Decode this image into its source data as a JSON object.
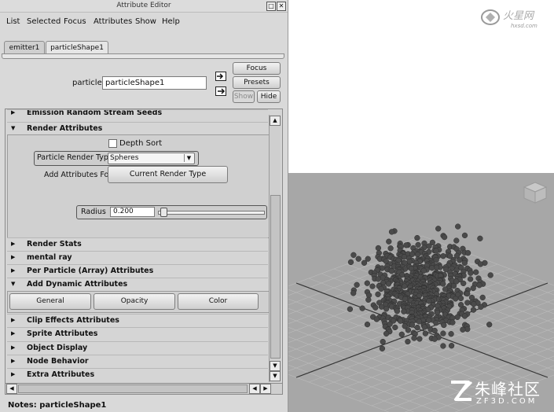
{
  "window": {
    "title": "Attribute Editor"
  },
  "menu": [
    "List",
    "Selected",
    "Focus",
    "Attributes",
    "Show",
    "Help"
  ],
  "tabs": [
    {
      "label": "emitter1"
    },
    {
      "label": "particleShape1"
    }
  ],
  "header": {
    "particle_label": "particle:",
    "particle_value": "particleShape1",
    "focus": "Focus",
    "presets": "Presets",
    "show": "Show",
    "hide": "Hide"
  },
  "sections": {
    "emission": "Emission Random Stream Seeds",
    "render": "Render Attributes",
    "render_stats": "Render Stats",
    "mental_ray": "mental ray",
    "per_particle": "Per Particle (Array) Attributes",
    "add_dynamic": "Add Dynamic Attributes",
    "clip_effects": "Clip Effects Attributes",
    "sprite": "Sprite Attributes",
    "object_display": "Object Display",
    "node_behavior": "Node Behavior",
    "extra": "Extra Attributes"
  },
  "render_attrs": {
    "depth_sort": "Depth Sort",
    "depth_sort_checked": false,
    "render_type_label": "Particle Render Type",
    "render_type_value": "Spheres",
    "add_attrs_label": "Add Attributes For",
    "current_render_type": "Current Render Type",
    "radius_label": "Radius",
    "radius_value": "0.200",
    "radius_fraction": 0.02
  },
  "dynamic_buttons": {
    "general": "General",
    "opacity": "Opacity",
    "color": "Color"
  },
  "notes": "Notes:  particleShape1",
  "watermark": {
    "top": "火星网 hxsd.com",
    "bottom": "朱峰社区",
    "bottom_sub": "ZF3D.COM"
  },
  "icons": [
    "maximize-icon",
    "close-icon",
    "load-icon",
    "copy-tab-icon",
    "triangle-right-icon",
    "triangle-down-icon",
    "scroll-up-icon",
    "scroll-down-icon",
    "scroll-left-icon",
    "scroll-right-icon",
    "dropdown-arrow-icon",
    "viewcube-icon"
  ],
  "viewport": {
    "description_color": "#a7a7a7",
    "particle_color": "#4a4a4a"
  }
}
